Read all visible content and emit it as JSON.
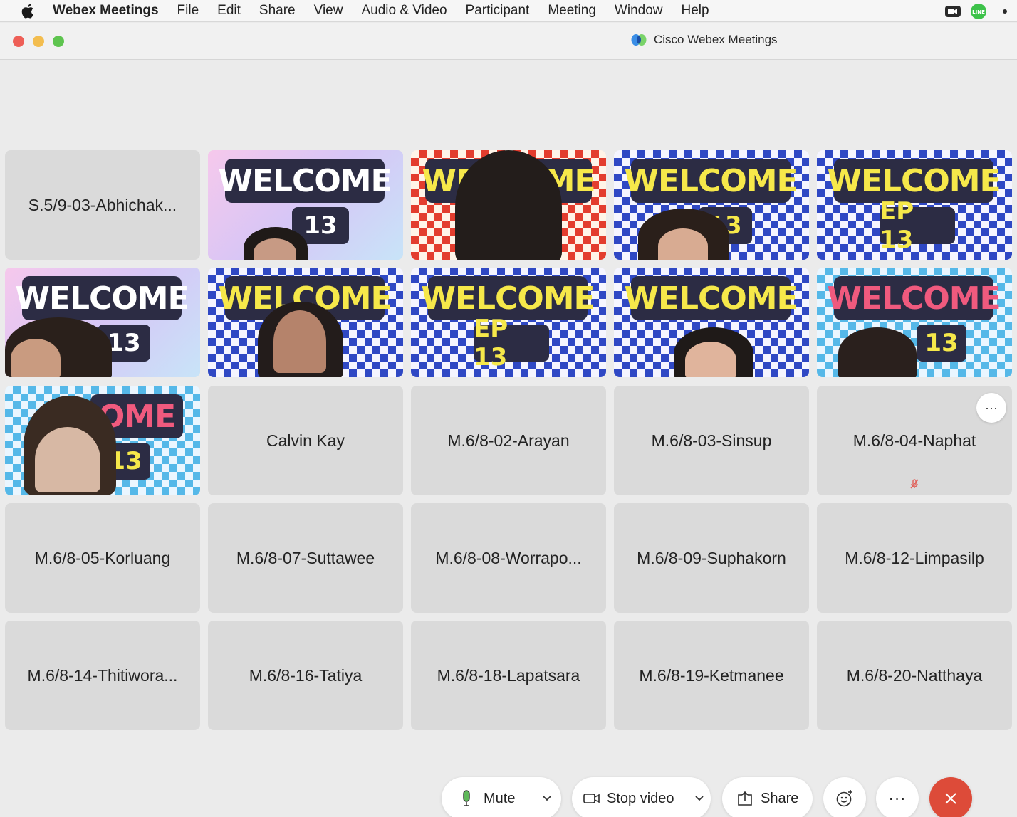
{
  "menubar": {
    "app_name": "Webex Meetings",
    "items": [
      "File",
      "Edit",
      "Share",
      "View",
      "Audio & Video",
      "Participant",
      "Meeting",
      "Window",
      "Help"
    ],
    "tray_icons": [
      "webex-camera-icon",
      "line-app-icon"
    ]
  },
  "window": {
    "title": "Cisco Webex Meetings"
  },
  "tiles": [
    {
      "name": "S.5/9-03-Abhichak...",
      "video": false
    },
    {
      "name": "",
      "video": true,
      "banner": "WELCOME",
      "ep": "13"
    },
    {
      "name": "",
      "video": true,
      "banner": "WELCOME"
    },
    {
      "name": "",
      "video": true,
      "banner": "WELCOME",
      "ep": "13"
    },
    {
      "name": "",
      "video": true,
      "banner": "WELCOME",
      "ep": "EP 13"
    },
    {
      "name": "",
      "video": true,
      "banner": "WELCOME",
      "ep": "13"
    },
    {
      "name": "",
      "video": true,
      "banner": "WELCOME"
    },
    {
      "name": "",
      "video": true,
      "banner": "WELCOME",
      "ep": "EP 13"
    },
    {
      "name": "",
      "video": true,
      "banner": "WELCOME"
    },
    {
      "name": "",
      "video": true,
      "banner": "WELCOME",
      "ep": "13"
    },
    {
      "name": "",
      "video": true,
      "banner": "OME",
      "ep": "13"
    },
    {
      "name": "Calvin Kay",
      "video": false
    },
    {
      "name": "M.6/8-02-Arayan",
      "video": false
    },
    {
      "name": "M.6/8-03-Sinsup",
      "video": false
    },
    {
      "name": "M.6/8-04-Naphat",
      "video": false,
      "more_button": "···",
      "muted": true
    },
    {
      "name": "M.6/8-05-Korluang",
      "video": false
    },
    {
      "name": "M.6/8-07-Suttawee",
      "video": false
    },
    {
      "name": "M.6/8-08-Worrapo...",
      "video": false
    },
    {
      "name": "M.6/8-09-Suphakorn",
      "video": false
    },
    {
      "name": "M.6/8-12-Limpasilp",
      "video": false
    },
    {
      "name": "M.6/8-14-Thitiwora...",
      "video": false
    },
    {
      "name": "M.6/8-16-Tatiya",
      "video": false
    },
    {
      "name": "M.6/8-18-Lapatsara",
      "video": false
    },
    {
      "name": "M.6/8-19-Ketmanee",
      "video": false
    },
    {
      "name": "M.6/8-20-Natthaya",
      "video": false
    }
  ],
  "controls": {
    "mute_label": "Mute",
    "stop_video_label": "Stop video",
    "share_label": "Share",
    "more_label": "···",
    "end_color": "#dd4b39"
  }
}
